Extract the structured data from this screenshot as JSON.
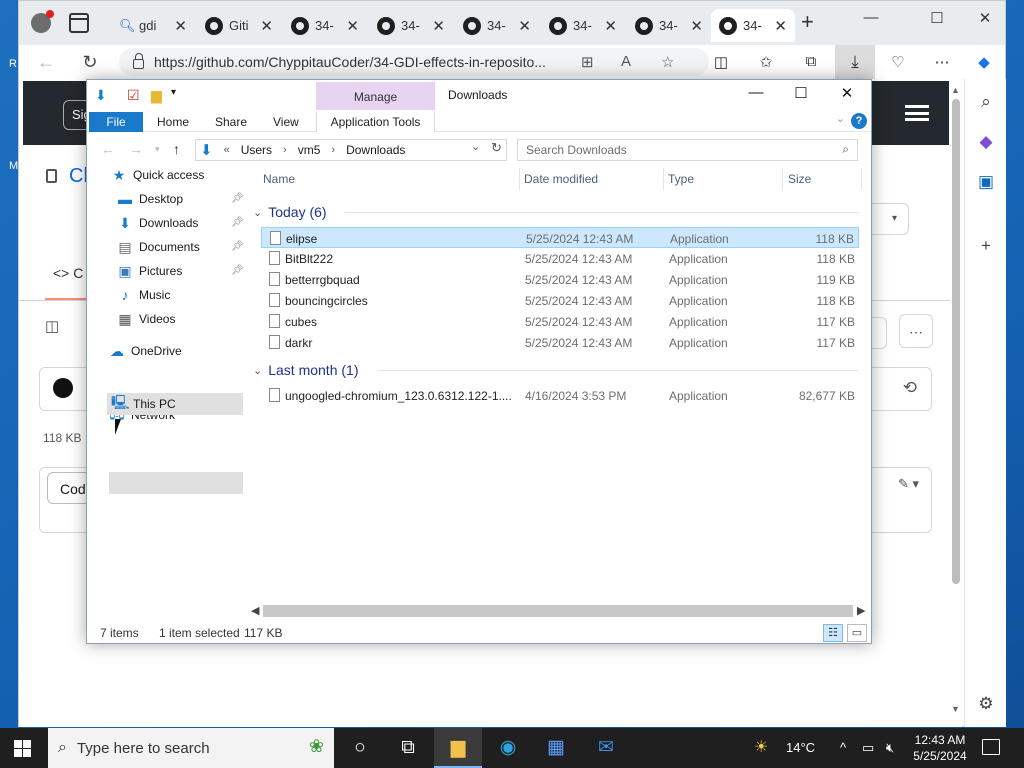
{
  "browser": {
    "tabs": [
      {
        "label": "gdi",
        "icon": "search-icon"
      },
      {
        "label": "Giti",
        "icon": "github-icon"
      },
      {
        "label": "34-",
        "icon": "github-icon"
      },
      {
        "label": "34-",
        "icon": "github-icon"
      },
      {
        "label": "34-",
        "icon": "github-icon"
      },
      {
        "label": "34-",
        "icon": "github-icon"
      },
      {
        "label": "34-",
        "icon": "github-icon"
      },
      {
        "label": "34-",
        "icon": "github-icon",
        "active": true
      }
    ],
    "url": "https://github.com/ChyppitauCoder/34-GDI-effects-in-reposito...",
    "page": {
      "signin_label": "Sig",
      "repo_text": "Cl",
      "code_tab": "<> C",
      "file_size": "118 KB",
      "code_button": "Cod"
    }
  },
  "desktop_labels": [
    "R",
    "M"
  ],
  "explorer": {
    "title": "Downloads",
    "manage_label": "Manage",
    "ribbon_tabs": {
      "file": "File",
      "home": "Home",
      "share": "Share",
      "view": "View",
      "app_tools": "Application Tools"
    },
    "help": "?",
    "breadcrumb": {
      "prefix": "«",
      "parts": [
        "Users",
        "vm5",
        "Downloads"
      ]
    },
    "search_placeholder": "Search Downloads",
    "nav": {
      "quick_access": "Quick access",
      "desktop": "Desktop",
      "downloads": "Downloads",
      "documents": "Documents",
      "pictures": "Pictures",
      "music": "Music",
      "videos": "Videos",
      "onedrive": "OneDrive",
      "this_pc": "This PC",
      "network": "Network"
    },
    "columns": {
      "name": "Name",
      "date": "Date modified",
      "type": "Type",
      "size": "Size"
    },
    "groups": [
      {
        "label": "Today (6)",
        "files": [
          {
            "name": "elipse",
            "date": "5/25/2024 12:43 AM",
            "type": "Application",
            "size": "118 KB",
            "selected": true
          },
          {
            "name": "BitBlt222",
            "date": "5/25/2024 12:43 AM",
            "type": "Application",
            "size": "118 KB"
          },
          {
            "name": "betterrgbquad",
            "date": "5/25/2024 12:43 AM",
            "type": "Application",
            "size": "119 KB"
          },
          {
            "name": "bouncingcircles",
            "date": "5/25/2024 12:43 AM",
            "type": "Application",
            "size": "118 KB"
          },
          {
            "name": "cubes",
            "date": "5/25/2024 12:43 AM",
            "type": "Application",
            "size": "117 KB"
          },
          {
            "name": "darkr",
            "date": "5/25/2024 12:43 AM",
            "type": "Application",
            "size": "117 KB"
          }
        ]
      },
      {
        "label": "Last month (1)",
        "files": [
          {
            "name": "ungoogled-chromium_123.0.6312.122-1....",
            "date": "4/16/2024 3:53 PM",
            "type": "Application",
            "size": "82,677 KB"
          }
        ]
      }
    ],
    "status": {
      "items": "7 items",
      "selected": "1 item selected",
      "selected_size": "117 KB"
    }
  },
  "taskbar": {
    "search_placeholder": "Type here to search",
    "weather": "14°C",
    "time": "12:43 AM",
    "date": "5/25/2024"
  },
  "colors": {
    "accent": "#1979ca",
    "selection": "#cce8ff",
    "manage_bg": "#e8d3f3",
    "taskbar": "#1f1f1f"
  }
}
